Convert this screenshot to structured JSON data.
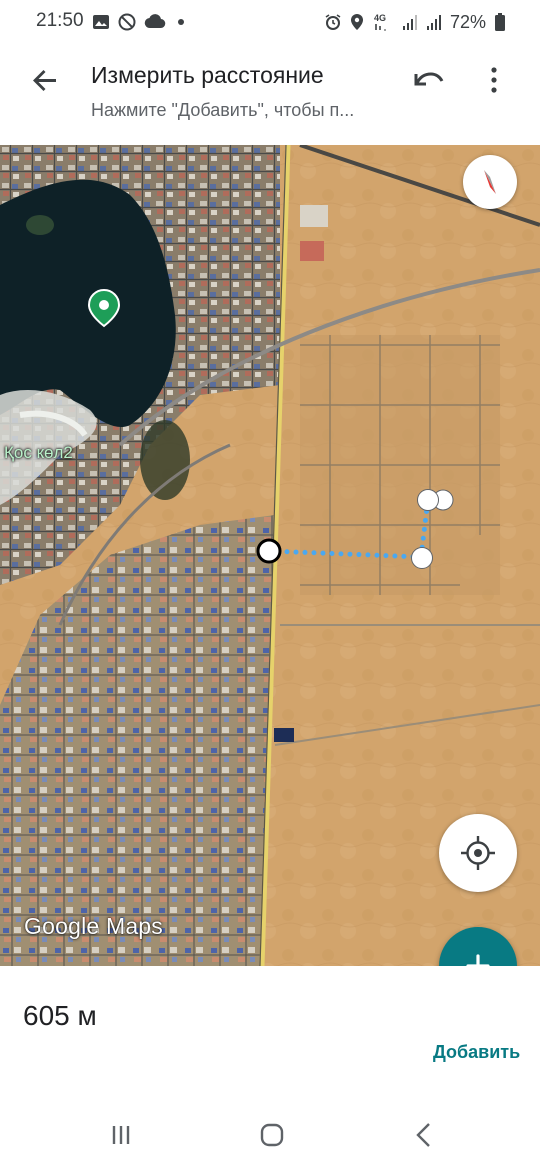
{
  "status_bar": {
    "time": "21:50",
    "battery_percent": "72%",
    "network": "4G",
    "icons_left": [
      "gallery-icon",
      "do-not-disturb-icon",
      "cloud-icon",
      "dot-icon"
    ],
    "icons_right": [
      "alarm-icon",
      "location-icon",
      "4g-icon",
      "signal-icon",
      "signal-icon-2",
      "battery-icon"
    ]
  },
  "app_bar": {
    "title": "Измерить расстояние",
    "subtitle": "Нажмите \"Добавить\", чтобы п...",
    "back_icon": "arrow-back-icon",
    "undo_icon": "undo-icon",
    "more_icon": "more-vert-icon"
  },
  "map": {
    "place_label": "Қос көл2",
    "logo": "Google Maps",
    "measure_line_color": "#4aa8f0",
    "accent": "#087a83"
  },
  "sheet": {
    "distance": "605 м",
    "add_label": "Добавить"
  },
  "colors": {
    "accent": "#087a83",
    "measure_line": "#4aa8f0",
    "place_pin": "#1e9e58"
  }
}
